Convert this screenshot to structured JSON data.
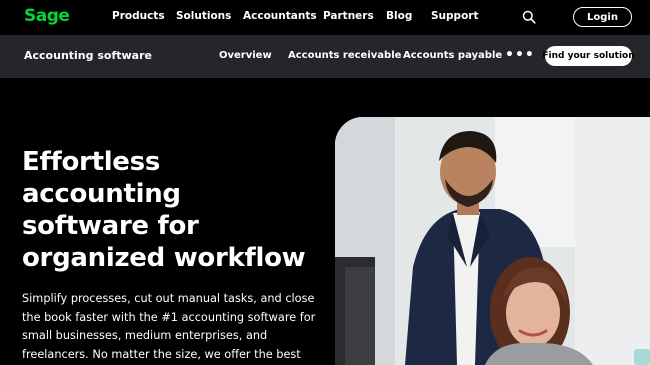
{
  "brand": {
    "logo_text": "Sage",
    "accent_color": "#00d639"
  },
  "topnav": {
    "items": [
      {
        "label": "Products"
      },
      {
        "label": "Solutions"
      },
      {
        "label": "Accountants"
      },
      {
        "label": "Partners"
      },
      {
        "label": "Blog"
      },
      {
        "label": "Support"
      }
    ],
    "search_icon": "search-icon",
    "login_label": "Login"
  },
  "subnav": {
    "title": "Accounting software",
    "links": [
      {
        "label": "Overview"
      },
      {
        "label": "Accounts receivable"
      },
      {
        "label": "Accounts payable"
      }
    ],
    "more_icon": "more-horizontal-icon",
    "cta_label": "Find your solution"
  },
  "hero": {
    "title_lines": [
      "Effortless",
      "accounting",
      "software for",
      "organized workflow"
    ],
    "body_lines": [
      "Simplify processes, cut out manual tasks, and close",
      "the book faster with the #1 accounting software for",
      "small businesses, medium enterprises, and",
      "freelancers. No matter the size, we offer the best"
    ]
  },
  "colors": {
    "background": "#000000",
    "subnav_background": "#25262a",
    "text": "#ffffff"
  }
}
